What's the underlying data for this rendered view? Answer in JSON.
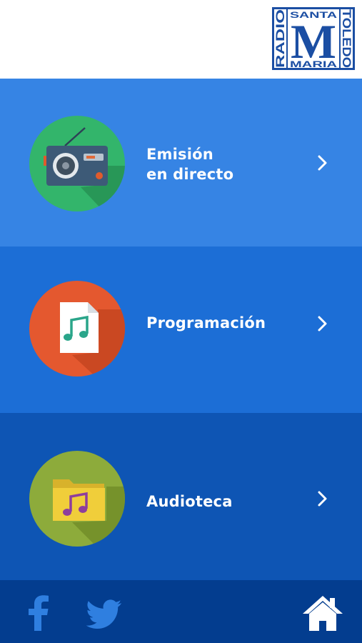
{
  "header": {
    "logo": {
      "word_left": "RADIO",
      "word_top": "SANTA",
      "letter": "M",
      "word_bottom": "MARIA",
      "word_right": "TOLEDO"
    }
  },
  "menu": [
    {
      "line1": "Emisión",
      "line2": "en directo",
      "icon": "radio-icon",
      "color": "#33b56b"
    },
    {
      "line1": "Programación",
      "icon": "music-file-icon",
      "color": "#e4582f"
    },
    {
      "line1": "Audioteca",
      "icon": "music-folder-icon",
      "color": "#8dab3b"
    }
  ],
  "footer": {
    "icons": [
      "facebook-icon",
      "twitter-icon",
      "home-icon"
    ]
  },
  "colors": {
    "panel1": "#3684e4",
    "panel2": "#1c6ed6",
    "panel3": "#0e55b4",
    "footer": "#033d8f",
    "logo": "#1b4ea3"
  }
}
